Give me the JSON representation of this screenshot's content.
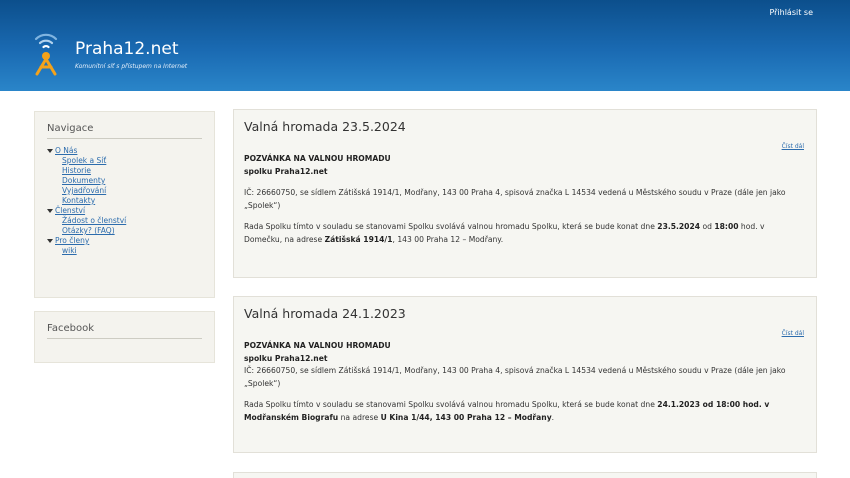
{
  "header": {
    "login": "Přihlásit se",
    "site_name": "Praha12.net",
    "slogan": "Komunitní síť s přístupem na Internet",
    "logo_icon": "wifi-tower-icon",
    "colors": {
      "header_dark": "#0c4f8c",
      "header_light": "#2a85c9",
      "logo_orange": "#f3a21b",
      "link": "#2c6cad"
    }
  },
  "sidebar": {
    "nav_title": "Navigace",
    "menu": [
      {
        "label": "O Nás",
        "children": [
          "Spolek a Síť",
          "Historie",
          "Dokumenty",
          "Vyjadřování",
          "Kontakty"
        ]
      },
      {
        "label": "Členství",
        "children": [
          "Žádost o členství",
          "Otázky? (FAQ)"
        ]
      },
      {
        "label": "Pro členy",
        "children": [
          "wiki"
        ]
      }
    ],
    "facebook_title": "Facebook"
  },
  "posts": [
    {
      "title": "Valná hromada 23.5.2024",
      "read_more": "Číst dál",
      "heading1": "POZVÁNKA NA VALNOU HROMADU",
      "heading2": "spolku Praha12.net",
      "p1": "IČ: 26660750, se sídlem Zátišská 1914/1, Modřany, 143 00 Praha 4, spisová značka L 14534 vedená u Městského soudu v Praze (dále jen jako „Spolek“)",
      "p2_a": "Rada Spolku tímto v souladu se stanovami Spolku svolává valnou hromadu Spolku, která se bude konat dne ",
      "p2_date": "23.5.2024",
      "p2_b": " od ",
      "p2_time": "18:00",
      "p2_c": " hod. v Domečku, na adrese ",
      "p2_addr": "Zátišská 1914/1",
      "p2_d": ", 143 00 Praha 12 – Modřany."
    },
    {
      "title": "Valná hromada 24.1.2023",
      "read_more": "Číst dál",
      "heading1": "POZVÁNKA NA VALNOU HROMADU",
      "heading2": "spolku Praha12.net",
      "p1": "IČ: 26660750, se sídlem Zátišská 1914/1, Modřany, 143 00 Praha 4, spisová značka L 14534 vedená u Městského soudu v Praze (dále jen jako „Spolek“)",
      "p2_a": "Rada Spolku tímto v souladu se stanovami Spolku svolává valnou hromadu Spolku, která se bude konat dne ",
      "p2_when": "24.1.2023 od 18:00 hod. v Modřanském Biografu",
      "p2_b": " na adrese ",
      "p2_addr": "U Kina 1/44, 143 00 Praha 12 – Modřany",
      "p2_c": "."
    }
  ]
}
